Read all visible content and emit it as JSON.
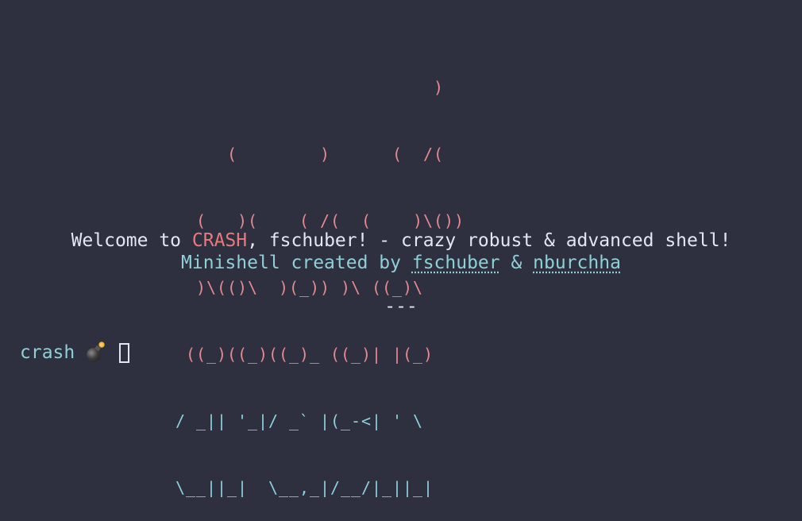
{
  "banner": {
    "art_lines": [
      "                                          )",
      "                      (        )      (  /(",
      "                   (   )(    ( /(  (    )\\())",
      "                   )\\(()\\  )(_)) )\\ ((_)\\",
      "                  ((_)((_)((_)_ ((_)| |(_)",
      "                 / _|| '_|/ _` |(_-<| ' \\",
      "                 \\__||_|  \\__,_|/__/|_||_|"
    ]
  },
  "welcome": {
    "prefix": "Welcome to ",
    "name": "CRASH",
    "suffix": ", fschuber! - crazy robust & advanced shell!"
  },
  "credits": {
    "prefix": "Minishell created by ",
    "author1": "fschuber",
    "joiner": " & ",
    "author2": "nburchha"
  },
  "divider": "---",
  "prompt": {
    "label": "crash",
    "icon": "bomb-icon"
  },
  "colors": {
    "background": "#2e3040",
    "flame_red": "#e78a8f",
    "flame_yellow": "#f0c878",
    "cyan": "#8fd0d6",
    "text": "#e4e5f4",
    "crash_accent": "#e8797c"
  }
}
